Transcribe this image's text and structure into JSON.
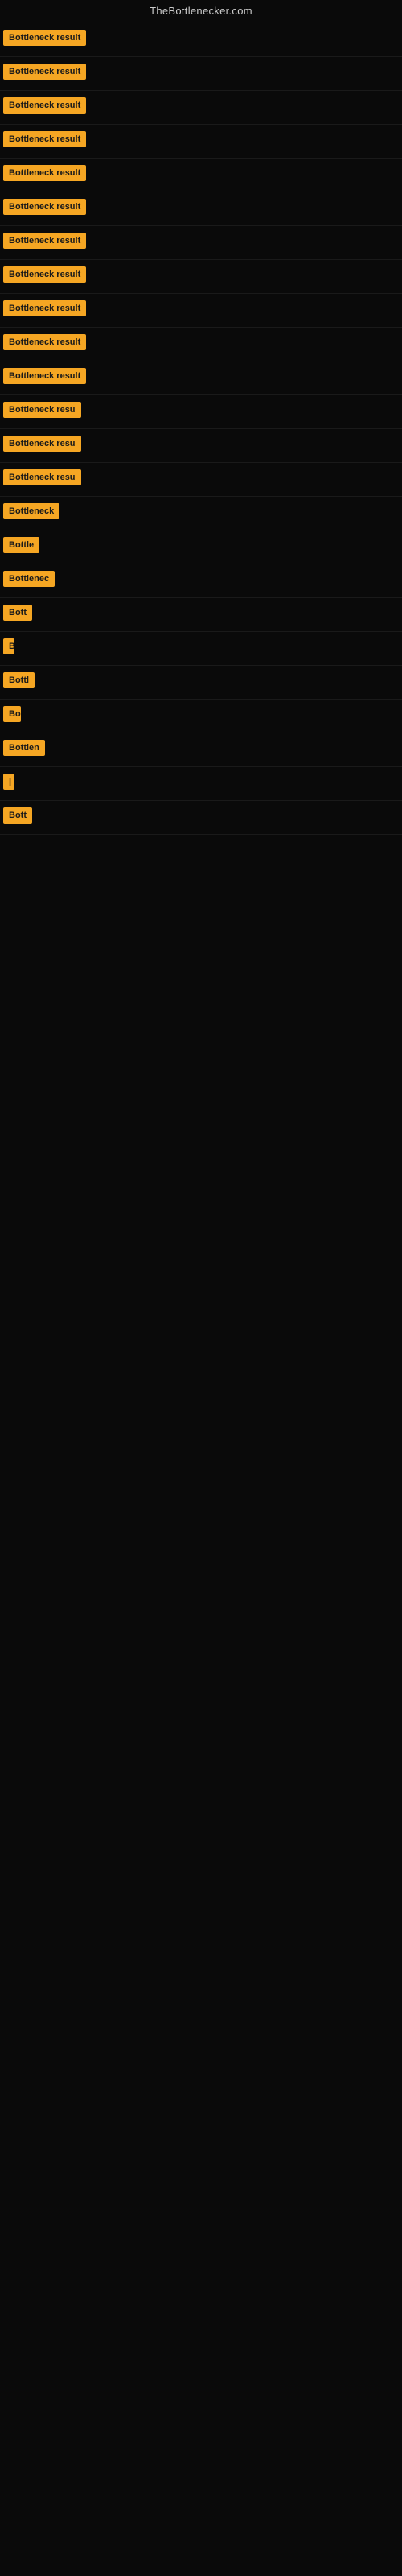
{
  "header": {
    "title": "TheBottlenecker.com"
  },
  "rows": [
    {
      "label": "Bottleneck result",
      "width": 120
    },
    {
      "label": "Bottleneck result",
      "width": 120
    },
    {
      "label": "Bottleneck result",
      "width": 120
    },
    {
      "label": "Bottleneck result",
      "width": 120
    },
    {
      "label": "Bottleneck result",
      "width": 120
    },
    {
      "label": "Bottleneck result",
      "width": 120
    },
    {
      "label": "Bottleneck result",
      "width": 120
    },
    {
      "label": "Bottleneck result",
      "width": 120
    },
    {
      "label": "Bottleneck result",
      "width": 120
    },
    {
      "label": "Bottleneck result",
      "width": 120
    },
    {
      "label": "Bottleneck result",
      "width": 120
    },
    {
      "label": "Bottleneck resu",
      "width": 105
    },
    {
      "label": "Bottleneck resu",
      "width": 105
    },
    {
      "label": "Bottleneck resu",
      "width": 105
    },
    {
      "label": "Bottleneck",
      "width": 78
    },
    {
      "label": "Bottle",
      "width": 52
    },
    {
      "label": "Bottlenec",
      "width": 68
    },
    {
      "label": "Bott",
      "width": 38
    },
    {
      "label": "B",
      "width": 14
    },
    {
      "label": "Bottl",
      "width": 42
    },
    {
      "label": "Bo",
      "width": 22
    },
    {
      "label": "Bottlen",
      "width": 56
    },
    {
      "label": "|",
      "width": 8
    },
    {
      "label": "Bott",
      "width": 38
    }
  ]
}
